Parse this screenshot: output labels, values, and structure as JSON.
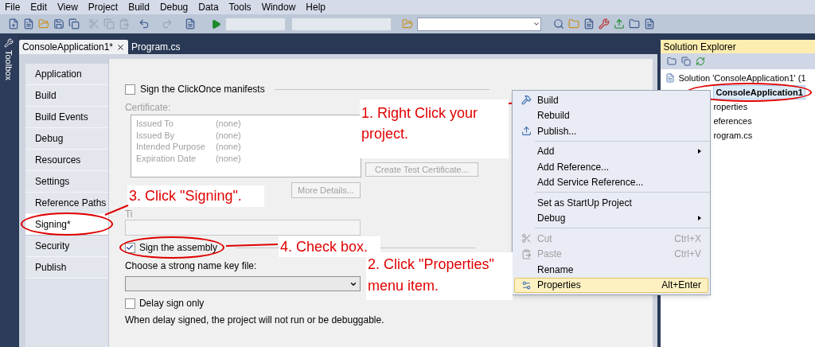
{
  "menu_bar": [
    "File",
    "Edit",
    "View",
    "Project",
    "Build",
    "Debug",
    "Data",
    "Tools",
    "Window",
    "Help"
  ],
  "toolbox": {
    "label": "Toolbox"
  },
  "tabs": [
    {
      "label": "ConsoleApplication1*",
      "selected": true
    },
    {
      "label": "Program.cs",
      "selected": false
    }
  ],
  "nav": [
    {
      "label": "Application",
      "selected": false
    },
    {
      "label": "Build",
      "selected": false
    },
    {
      "label": "Build Events",
      "selected": false
    },
    {
      "label": "Debug",
      "selected": false
    },
    {
      "label": "Resources",
      "selected": false
    },
    {
      "label": "Settings",
      "selected": false
    },
    {
      "label": "Reference Paths",
      "selected": false
    },
    {
      "label": "Signing*",
      "selected": true
    },
    {
      "label": "Security",
      "selected": false
    },
    {
      "label": "Publish",
      "selected": false
    }
  ],
  "signing": {
    "clickonce": {
      "label": "Sign the ClickOnce manifests",
      "checked": false
    },
    "certificate_label": "Certificate:",
    "certificate": [
      {
        "label": "Issued To",
        "value": "(none)"
      },
      {
        "label": "Issued By",
        "value": "(none)"
      },
      {
        "label": "Intended Purpose",
        "value": "(none)"
      },
      {
        "label": "Expiration Date",
        "value": "(none)"
      }
    ],
    "create_button": "Create Test Certificate...",
    "details_button": "More Details...",
    "timestamp_label": "Ti",
    "assembly": {
      "label": "Sign the assembly",
      "checked": true
    },
    "key_label": "Choose a strong name key file:",
    "delay": {
      "label": "Delay sign only",
      "checked": false
    },
    "delay_note": "When delay signed, the project will not run or be debuggable."
  },
  "solution_explorer": {
    "title": "Solution Explorer",
    "tree": [
      {
        "label": "Solution 'ConsoleApplication1' (1",
        "selected": false,
        "children": [
          {
            "label": "ConsoleApplication1",
            "selected": true,
            "children": [
              {
                "label": "roperties",
                "selected": false
              },
              {
                "label": "eferences",
                "selected": false
              },
              {
                "label": "rogram.cs",
                "selected": false
              }
            ]
          }
        ]
      }
    ]
  },
  "context_menu": [
    {
      "kind": "item",
      "label": "Build",
      "disabled": false,
      "selected": false,
      "submenu": false
    },
    {
      "kind": "item",
      "label": "Rebuild",
      "disabled": false,
      "selected": false,
      "submenu": false
    },
    {
      "kind": "item",
      "label": "Publish...",
      "disabled": false,
      "selected": false,
      "submenu": false
    },
    {
      "kind": "separator"
    },
    {
      "kind": "item",
      "label": "Add",
      "disabled": false,
      "selected": false,
      "submenu": true
    },
    {
      "kind": "item",
      "label": "Add Reference...",
      "disabled": false,
      "selected": false,
      "submenu": false
    },
    {
      "kind": "item",
      "label": "Add Service Reference...",
      "disabled": false,
      "selected": false,
      "submenu": false
    },
    {
      "kind": "separator"
    },
    {
      "kind": "item",
      "label": "Set as StartUp Project",
      "disabled": false,
      "selected": false,
      "submenu": false
    },
    {
      "kind": "item",
      "label": "Debug",
      "disabled": false,
      "selected": false,
      "submenu": true
    },
    {
      "kind": "separator"
    },
    {
      "kind": "item",
      "label": "Cut",
      "shortcut": "Ctrl+X",
      "disabled": true,
      "selected": false,
      "submenu": false
    },
    {
      "kind": "item",
      "label": "Paste",
      "shortcut": "Ctrl+V",
      "disabled": true,
      "selected": false,
      "submenu": false
    },
    {
      "kind": "item",
      "label": "Rename",
      "disabled": false,
      "selected": false,
      "submenu": false
    },
    {
      "kind": "item",
      "label": "Properties",
      "shortcut": "Alt+Enter",
      "disabled": false,
      "selected": true,
      "submenu": false
    }
  ],
  "annotations": [
    "1. Right Click your project.",
    "2. Click \"Properties\" menu item.",
    "3. Click \"Signing\".",
    "4. Check box."
  ]
}
